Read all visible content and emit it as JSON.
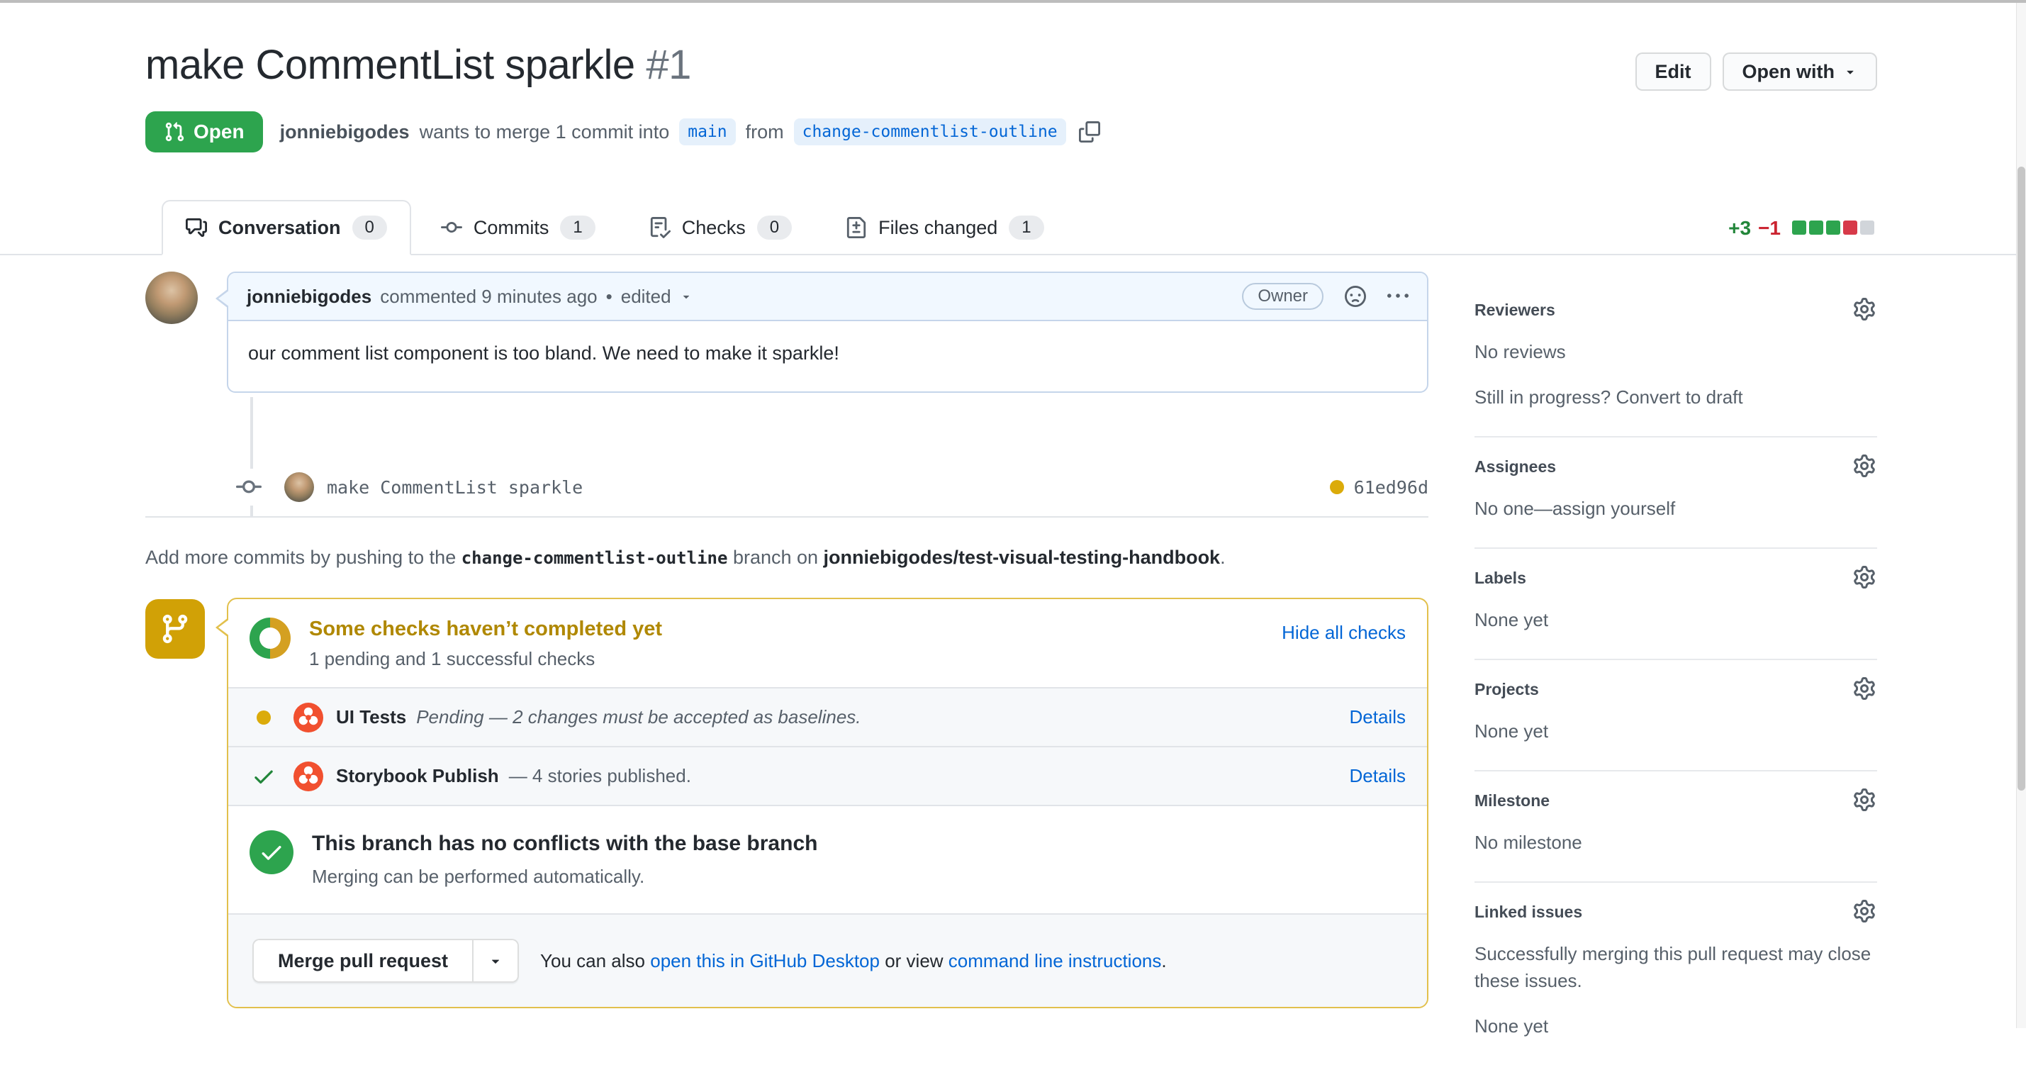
{
  "colors": {
    "open_green": "#2da44e",
    "pending_yellow": "#dbab0a",
    "success_green": "#22863a",
    "link_blue": "#0366d6",
    "danger_red": "#cb2431",
    "attention_border": "#e2c04c",
    "attention_text": "#b08800",
    "chromatic_orange": "#f1502f"
  },
  "header": {
    "title": "make CommentList sparkle",
    "number": "#1",
    "edit_label": "Edit",
    "open_with_label": "Open with",
    "state_badge": "Open",
    "author": "jonniebigodes",
    "meta_text_1": "wants to merge 1 commit into",
    "base_branch": "main",
    "meta_text_2": "from",
    "head_branch": "change-commentlist-outline"
  },
  "tabs": [
    {
      "label": "Conversation",
      "count": "0"
    },
    {
      "label": "Commits",
      "count": "1"
    },
    {
      "label": "Checks",
      "count": "0"
    },
    {
      "label": "Files changed",
      "count": "1"
    }
  ],
  "diffstat": {
    "additions": "+3",
    "deletions": "−1",
    "blocks": [
      "add",
      "add",
      "add",
      "del",
      "neutral"
    ]
  },
  "comment": {
    "author": "jonniebigodes",
    "action_time": "commented 9 minutes ago",
    "sep": "•",
    "edited": "edited",
    "owner_badge": "Owner",
    "body": "our comment list component is too bland. We need to make it sparkle!"
  },
  "commit": {
    "message": "make CommentList sparkle",
    "sha": "61ed96d"
  },
  "push_hint": {
    "pre": "Add more commits by pushing to the",
    "branch": "change-commentlist-outline",
    "mid": "branch on",
    "repo": "jonniebigodes/test-visual-testing-handbook",
    "post": "."
  },
  "checks": {
    "title": "Some checks haven’t completed yet",
    "subtitle": "1 pending and 1 successful checks",
    "hide_link": "Hide all checks",
    "rows": [
      {
        "name": "UI Tests",
        "description": "Pending — 2 changes must be accepted as baselines.",
        "details": "Details"
      },
      {
        "name": "Storybook Publish",
        "description": "— 4 stories published.",
        "details": "Details"
      }
    ],
    "conflicts_title": "This branch has no conflicts with the base branch",
    "conflicts_sub": "Merging can be performed automatically.",
    "merge_button": "Merge pull request",
    "also_pre": "You can also",
    "desktop_link": "open this in GitHub Desktop",
    "also_mid": "or view",
    "cli_link": "command line instructions",
    "also_post": "."
  },
  "sidebar": {
    "sections": [
      {
        "title": "Reviewers",
        "value": "No reviews",
        "hint_pre": "Still in progress?",
        "hint_link": "Convert to draft"
      },
      {
        "title": "Assignees",
        "value_pre": "No one—",
        "value_link": "assign yourself"
      },
      {
        "title": "Labels",
        "value": "None yet"
      },
      {
        "title": "Projects",
        "value": "None yet"
      },
      {
        "title": "Milestone",
        "value": "No milestone"
      },
      {
        "title": "Linked issues",
        "desc": "Successfully merging this pull request may close these issues.",
        "value": "None yet"
      }
    ]
  }
}
